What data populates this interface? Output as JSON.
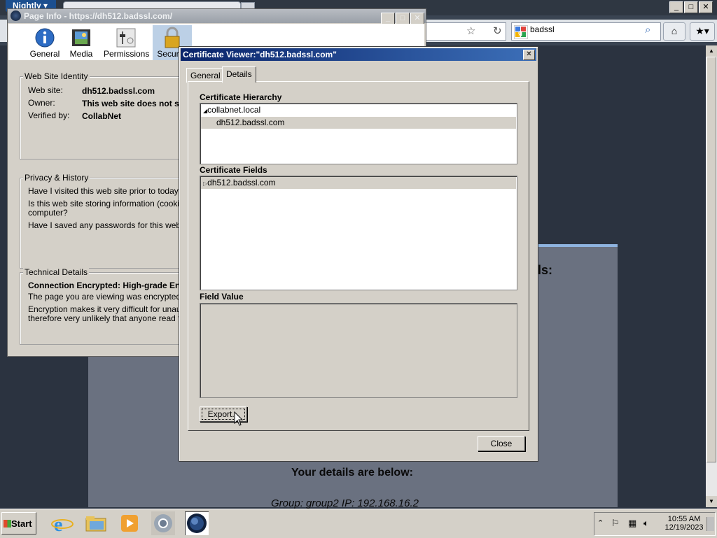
{
  "browser": {
    "app_menu_label": "Nightly",
    "search_engine": "google-icon",
    "search_value": "badssl",
    "window_buttons": [
      "_",
      "□",
      "✕"
    ]
  },
  "page_info": {
    "title": "Page Info - https://dh512.badssl.com/",
    "tools": [
      {
        "label": "General",
        "icon": "info-icon"
      },
      {
        "label": "Media",
        "icon": "media-icon"
      },
      {
        "label": "Permissions",
        "icon": "permissions-icon"
      },
      {
        "label": "Security",
        "icon": "lock-icon"
      }
    ],
    "identity": {
      "legend": "Web Site Identity",
      "website_label": "Web site:",
      "website_value": "dh512.badssl.com",
      "owner_label": "Owner:",
      "owner_value": "This web site does not su",
      "verified_label": "Verified by:",
      "verified_value": "CollabNet"
    },
    "privacy": {
      "legend": "Privacy & History",
      "q1": "Have I visited this web site prior to today?",
      "q2a": "Is this web site storing information (cookies) o",
      "q2b": "computer?",
      "q3": "Have I saved any passwords for this web site"
    },
    "technical": {
      "legend": "Technical Details",
      "line1": "Connection Encrypted: High-grade Enc",
      "line2": "The page you are viewing was encrypted bef",
      "line3": "Encryption makes it very difficult for unautho",
      "line4": "therefore very unlikely that anyone read this"
    }
  },
  "cert_viewer": {
    "title": "Certificate Viewer:\"dh512.badssl.com\"",
    "tabs": [
      "General",
      "Details"
    ],
    "active_tab": "Details",
    "hierarchy_label": "Certificate Hierarchy",
    "hierarchy": [
      {
        "label": "collabnet.local",
        "expanded": true
      },
      {
        "label": "dh512.badssl.com",
        "selected": true
      }
    ],
    "fields_label": "Certificate Fields",
    "fields": [
      {
        "label": "dh512.badssl.com",
        "collapsed": true
      }
    ],
    "field_value_label": "Field Value",
    "field_value": "",
    "export_button": "Export...",
    "close_button": "Close"
  },
  "page_content": {
    "partial_heading": "ls:",
    "details_heading": "Your details are below:",
    "details_line": "Group: group2   IP: 192.168.16.2"
  },
  "taskbar": {
    "start_label": "Start",
    "apps": [
      "ie-icon",
      "explorer-folder-icon",
      "media-player-icon",
      "chrome-icon",
      "nightly-icon"
    ],
    "time": "10:55 AM",
    "date": "12/19/2023"
  }
}
